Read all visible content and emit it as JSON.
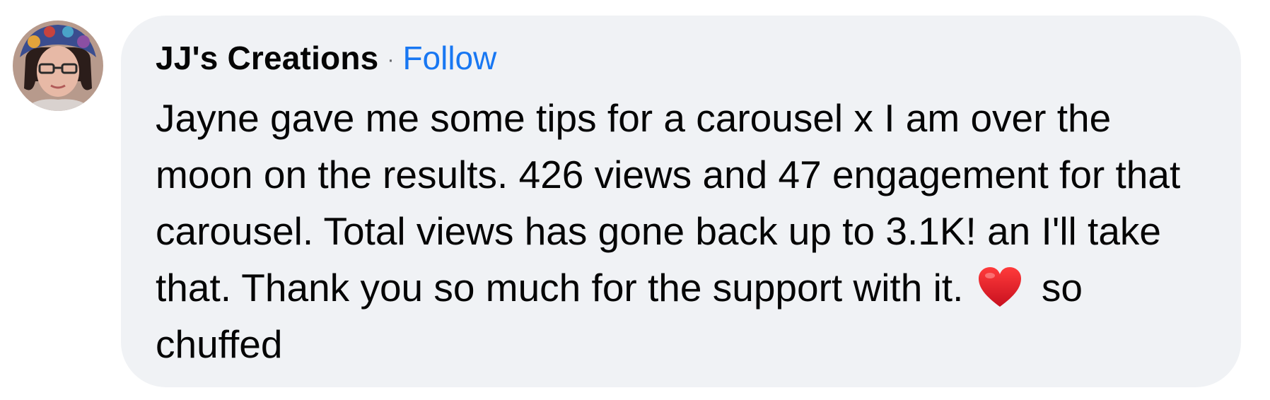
{
  "comment": {
    "author": "JJ's Creations",
    "separator": "·",
    "follow_label": "Follow",
    "text_before_emoji": "Jayne gave me some tips for a carousel x I am over the moon on the results. 426 views and 47 engagement for that carousel. Total views has gone back up to 3.1K! an I'll take that. Thank you so much for the support with it.",
    "emoji": "heart-emoji",
    "text_after_emoji": "so chuffed"
  },
  "colors": {
    "bubble_bg": "#f0f2f5",
    "author_text": "#050505",
    "follow_link": "#1877f2",
    "heart": "#e0202e"
  }
}
